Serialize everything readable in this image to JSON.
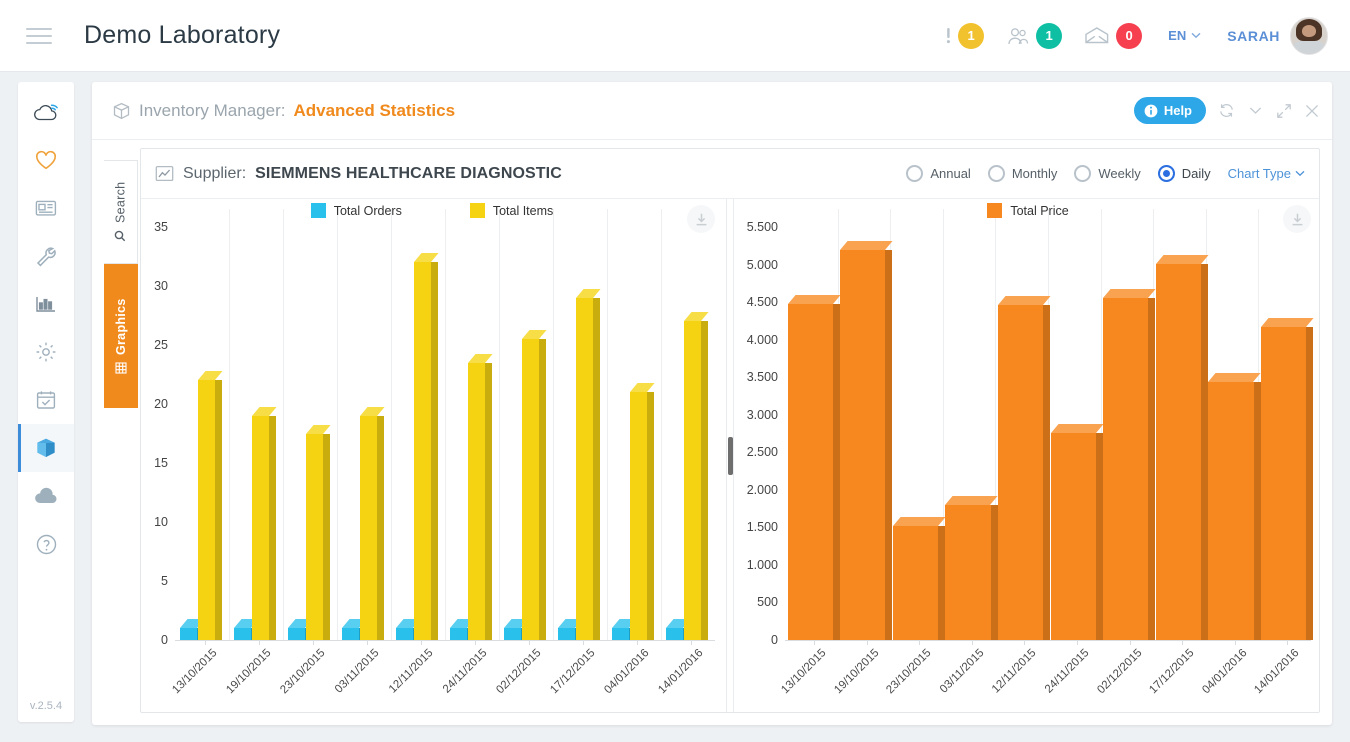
{
  "header": {
    "app_title": "Demo Laboratory",
    "menu_icon": "hamburger-icon",
    "alerts": {
      "icon": "exclamation-icon",
      "count": "1",
      "color": "#f2c12e"
    },
    "users": {
      "icon": "users-icon",
      "count": "1",
      "color": "#0fbfa4"
    },
    "messages": {
      "icon": "envelope-icon",
      "count": "0",
      "color": "#f6404f"
    },
    "language": "EN",
    "user_name": "SARAH"
  },
  "sidebar": {
    "version": "v.2.5.4",
    "items": [
      {
        "name": "cloud-wifi-logo-icon",
        "active": false
      },
      {
        "name": "heart-icon",
        "active": false
      },
      {
        "name": "news-card-icon",
        "active": false
      },
      {
        "name": "wrench-icon",
        "active": false
      },
      {
        "name": "bar-chart-icon",
        "active": false
      },
      {
        "name": "gear-icon",
        "active": false
      },
      {
        "name": "calendar-check-icon",
        "active": false
      },
      {
        "name": "box-icon",
        "active": true
      },
      {
        "name": "cloud-icon",
        "active": false
      },
      {
        "name": "help-circle-icon",
        "active": false
      }
    ]
  },
  "card": {
    "module_label": "Inventory Manager:",
    "module_page": "Advanced Statistics",
    "help_label": "Help",
    "window_icons": [
      "refresh-icon",
      "chevron-down-icon",
      "expand-icon",
      "close-icon"
    ]
  },
  "vtabs": [
    {
      "label": "Search",
      "icon": "search-icon",
      "active": false
    },
    {
      "label": "Graphics",
      "icon": "grid-icon",
      "active": true
    }
  ],
  "toolbar": {
    "supplier_label": "Supplier:",
    "supplier_value": "SIEMMENS HEALTHCARE DIAGNOSTIC",
    "periods": [
      {
        "label": "Annual",
        "selected": false
      },
      {
        "label": "Monthly",
        "selected": false
      },
      {
        "label": "Weekly",
        "selected": false
      },
      {
        "label": "Daily",
        "selected": true
      }
    ],
    "chart_type_label": "Chart Type"
  },
  "colors": {
    "orders": "#29c0ec",
    "items": "#f5d312",
    "price": "#f7881f",
    "accent": "#f08a1d",
    "link": "#4e93d8"
  },
  "chart_data": [
    {
      "type": "bar",
      "title": "",
      "xlabel": "",
      "ylabel": "",
      "ylim": [
        0,
        35
      ],
      "yticks": [
        0,
        5,
        10,
        15,
        20,
        25,
        30,
        35
      ],
      "ytick_labels": [
        "0",
        "5",
        "10",
        "15",
        "20",
        "25",
        "30",
        "35"
      ],
      "grid": true,
      "legend_position": "top",
      "categories": [
        "13/10/2015",
        "19/10/2015",
        "23/10/2015",
        "03/11/2015",
        "12/11/2015",
        "24/11/2015",
        "02/12/2015",
        "17/12/2015",
        "04/01/2016",
        "14/01/2016"
      ],
      "series": [
        {
          "name": "Total Orders",
          "color": "#29c0ec",
          "values": [
            1,
            1,
            1,
            1,
            1,
            1,
            1,
            1,
            1,
            1
          ]
        },
        {
          "name": "Total Items",
          "color": "#f5d312",
          "values": [
            22,
            19,
            17.5,
            19,
            32,
            23.5,
            25.5,
            29,
            21,
            27
          ]
        }
      ]
    },
    {
      "type": "bar",
      "title": "",
      "xlabel": "",
      "ylabel": "",
      "ylim": [
        0,
        5500
      ],
      "yticks": [
        0,
        500,
        1000,
        1500,
        2000,
        2500,
        3000,
        3500,
        4000,
        4500,
        5000,
        5500
      ],
      "ytick_labels": [
        "0",
        "500",
        "1.000",
        "1.500",
        "2.000",
        "2.500",
        "3.000",
        "3.500",
        "4.000",
        "4.500",
        "5.000",
        "5.500"
      ],
      "grid": true,
      "legend_position": "top",
      "categories": [
        "13/10/2015",
        "19/10/2015",
        "23/10/2015",
        "03/11/2015",
        "12/11/2015",
        "24/11/2015",
        "02/12/2015",
        "17/12/2015",
        "04/01/2016",
        "14/01/2016"
      ],
      "series": [
        {
          "name": "Total Price",
          "color": "#f7881f",
          "values": [
            4480,
            5200,
            1520,
            1800,
            4460,
            2760,
            4560,
            5010,
            3440,
            4170
          ]
        }
      ]
    }
  ]
}
